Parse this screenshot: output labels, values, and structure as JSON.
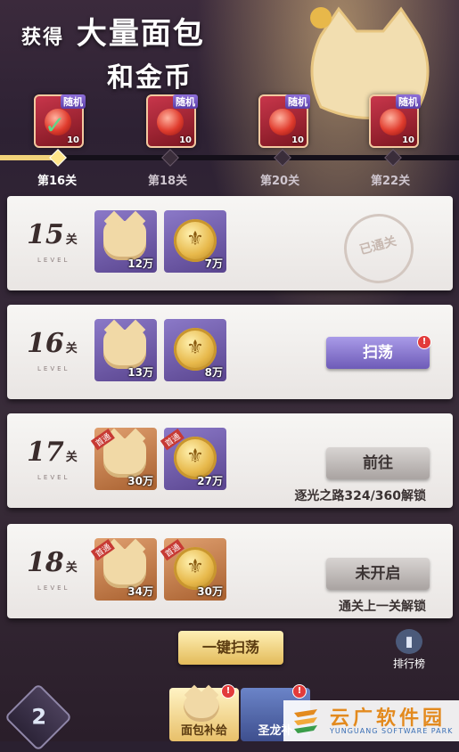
{
  "header": {
    "title_line1_a": "获得",
    "title_line1_b": "大量面包",
    "title_line2": "和金币"
  },
  "rewards": [
    {
      "tag": "随机",
      "count": "10",
      "claimed": true
    },
    {
      "tag": "随机",
      "count": "10",
      "claimed": false
    },
    {
      "tag": "随机",
      "count": "10",
      "claimed": false
    },
    {
      "tag": "随机",
      "count": "10",
      "claimed": false
    }
  ],
  "stages": [
    "第16关",
    "第18关",
    "第20关",
    "第22关"
  ],
  "progress": 0.13,
  "levels": [
    {
      "num": "15",
      "suffix": "关",
      "sub": "LEVEL",
      "items": [
        {
          "amount": "12万",
          "first": ""
        },
        {
          "amount": "7万",
          "first": ""
        }
      ],
      "status": "已通关"
    },
    {
      "num": "16",
      "suffix": "关",
      "sub": "LEVEL",
      "items": [
        {
          "amount": "13万",
          "first": ""
        },
        {
          "amount": "8万",
          "first": ""
        }
      ],
      "button": "扫荡"
    },
    {
      "num": "17",
      "suffix": "关",
      "sub": "LEVEL",
      "items": [
        {
          "amount": "30万",
          "first": "首通"
        },
        {
          "amount": "27万",
          "first": "首通"
        }
      ],
      "button": "前往",
      "unlock": "逐光之路324/360解锁"
    },
    {
      "num": "18",
      "suffix": "关",
      "sub": "LEVEL",
      "items": [
        {
          "amount": "34万",
          "first": "首通"
        },
        {
          "amount": "30万",
          "first": "首通"
        }
      ],
      "button": "未开启",
      "unlock": "通关上一关解锁"
    }
  ],
  "bottom": {
    "onekey": "一键扫荡",
    "rank": "排行榜",
    "tab1": "面包补给",
    "tab2": "圣龙补"
  },
  "watermark": {
    "title": "云广软件园",
    "sub": "YUNGUANG SOFTWARE PARK"
  },
  "colors": {
    "accent": "#f1d27a",
    "sweep": "#8e7ad8",
    "badge": "#e23b3b"
  }
}
